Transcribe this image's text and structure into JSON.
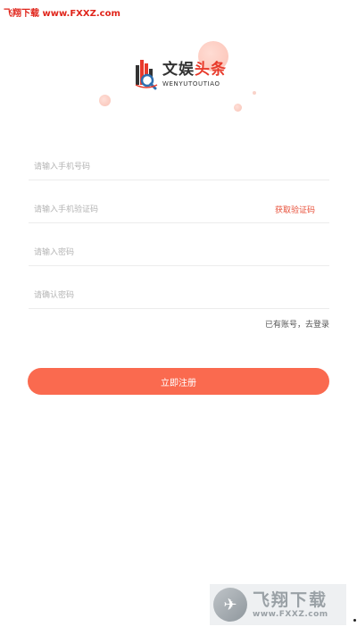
{
  "watermark": {
    "top_text": "飞翔下载 www.FXXZ.com",
    "bottom_cn": "飞翔下载",
    "bottom_en": "www.FXXZ.com"
  },
  "logo": {
    "name_part1": "文娱",
    "name_part2": "头条",
    "subtitle": "WENYUTOUTIAO"
  },
  "form": {
    "phone_placeholder": "请输入手机号码",
    "code_placeholder": "请输入手机验证码",
    "get_code_label": "获取验证码",
    "password_placeholder": "请输入密码",
    "confirm_placeholder": "请确认密码",
    "login_link": "已有账号，去登录",
    "submit_label": "立即注册"
  },
  "colors": {
    "accent": "#fa6a4f",
    "link": "#e8503a",
    "brand_red": "#e8392a"
  }
}
